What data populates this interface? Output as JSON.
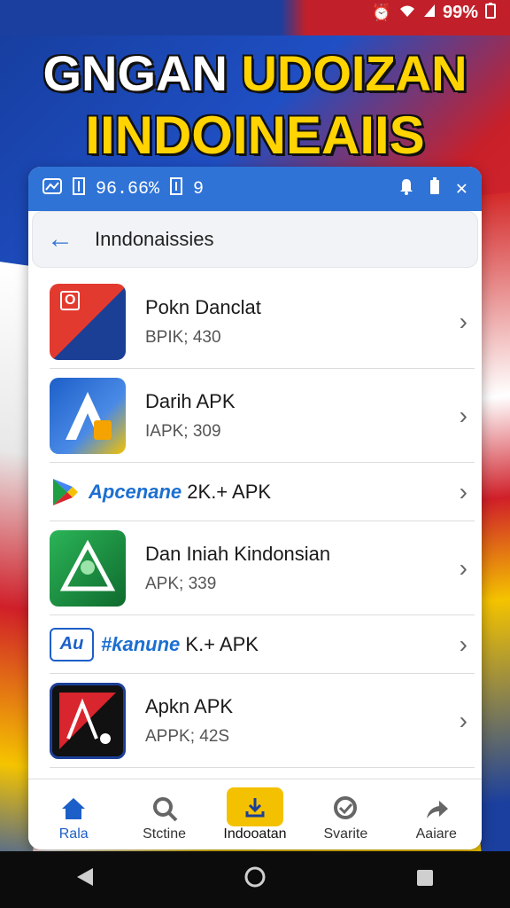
{
  "status": {
    "battery": "99%"
  },
  "headline": {
    "line1_white": "GNGAN",
    "line1_yellow": "UDOIZAN",
    "line2": "IINDOINEAIIS"
  },
  "card_header": {
    "left_text": "96.66%",
    "right_text": "9"
  },
  "search": {
    "query": "Inndonaissies"
  },
  "apps": [
    {
      "name": "Pokn Danclat",
      "meta": "BPIK; 430",
      "colors": [
        "#d9252d",
        "#1c3f96"
      ]
    },
    {
      "name": "Darih APK",
      "meta": "IAPK; 309",
      "colors": [
        "#1c5fc8",
        "#f4c100"
      ]
    },
    {
      "brand": "Apcenane",
      "rest": "2K.+ APK"
    },
    {
      "name": "Dan Iniah Kindonsian",
      "meta": "APK; 339",
      "colors": [
        "#1e9e45",
        "#0f6b2e"
      ]
    },
    {
      "brand_icon": "Au",
      "brand": "#kanune",
      "rest": "K.+ APK"
    },
    {
      "name": "Apkn APK",
      "meta": "APPK; 42S",
      "colors": [
        "#d9252d",
        "#111111"
      ]
    }
  ],
  "nav": [
    {
      "label": "Rala",
      "icon": "home-icon"
    },
    {
      "label": "Stctine",
      "icon": "search-icon"
    },
    {
      "label": "Indooatan",
      "icon": "download-icon"
    },
    {
      "label": "Svarite",
      "icon": "chat-icon"
    },
    {
      "label": "Aaiare",
      "icon": "share-icon"
    }
  ],
  "colors": {
    "accent": "#2f73d6",
    "yellow": "#f4c100",
    "red": "#d9252d"
  }
}
